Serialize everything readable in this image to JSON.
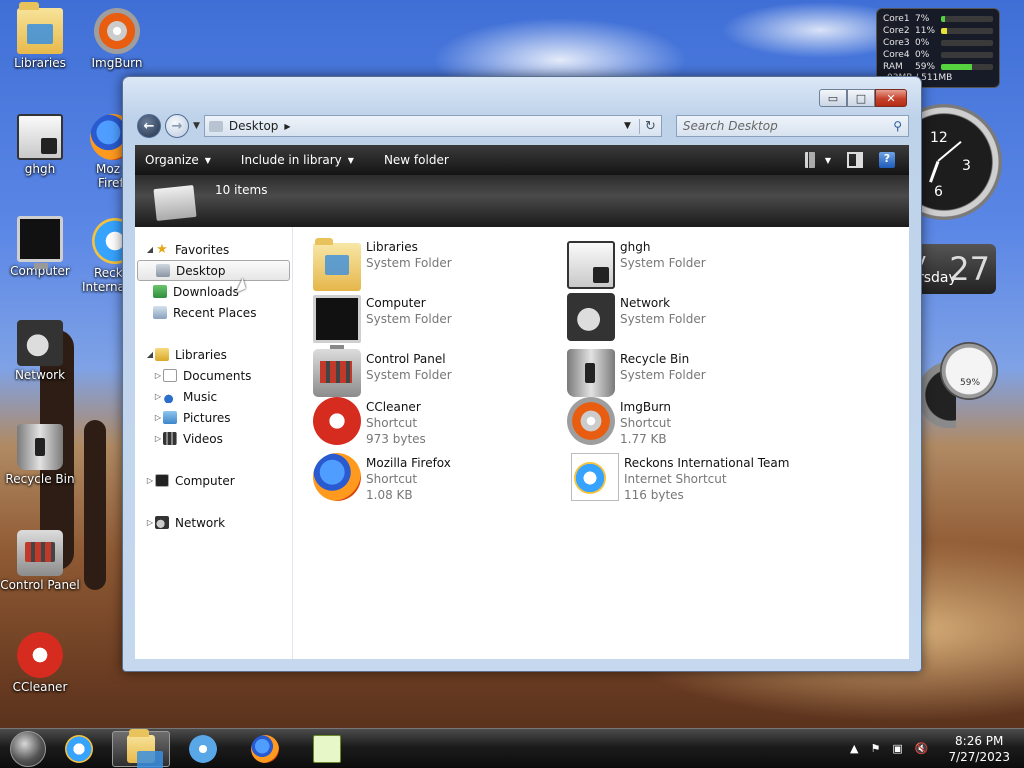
{
  "desktop": {
    "icons": [
      {
        "label": "Libraries",
        "icon": "libraries-icon"
      },
      {
        "label": "ImgBurn",
        "icon": "imgburn-icon"
      },
      {
        "label": "ghgh",
        "icon": "ghgh-icon"
      },
      {
        "label": "Moz",
        "sublabel": "Firef",
        "icon": "firefox-icon"
      },
      {
        "label": "Computer",
        "icon": "computer-icon"
      },
      {
        "label": "Reck",
        "sublabel": "Internat",
        "icon": "ie-icon"
      },
      {
        "label": "Network",
        "icon": "network-icon"
      },
      {
        "label": "Recycle Bin",
        "icon": "recycle-bin-icon"
      },
      {
        "label": "Control Panel",
        "icon": "control-panel-icon"
      },
      {
        "label": "CCleaner",
        "icon": "ccleaner-icon"
      }
    ]
  },
  "gadgets": {
    "cpu": {
      "rows": [
        {
          "label": "Core1",
          "value": "7%",
          "level": 0.07
        },
        {
          "label": "Core2",
          "value": "11%",
          "level": 0.11
        },
        {
          "label": "Core3",
          "value": "0%",
          "level": 0
        },
        {
          "label": "Core4",
          "value": "0%",
          "level": 0
        },
        {
          "label": "RAM",
          "value": "59%",
          "level": 0.59
        }
      ],
      "memory": "03MB / 511MB"
    },
    "clock": {
      "n12": "12",
      "n3": "3",
      "n6": "6"
    },
    "calendar": {
      "day": "y",
      "weekday": "rsday",
      "date": "27"
    },
    "meter": {
      "value": "59%"
    }
  },
  "window": {
    "caption": {
      "minimize": "▭",
      "maximize": "□",
      "close": "✕"
    },
    "address": {
      "location": "Desktop"
    },
    "search": {
      "placeholder": "Search Desktop"
    },
    "toolbar": {
      "organize": "Organize",
      "include_in_library": "Include in library",
      "new_folder": "New folder"
    },
    "details": {
      "count": "10 items"
    },
    "nav": {
      "favorites": "Favorites",
      "desktop": "Desktop",
      "downloads": "Downloads",
      "recent_places": "Recent Places",
      "libraries": "Libraries",
      "documents": "Documents",
      "music": "Music",
      "pictures": "Pictures",
      "videos": "Videos",
      "computer": "Computer",
      "network": "Network"
    },
    "files": [
      {
        "name": "Libraries",
        "type": "System Folder",
        "icon": "libraries-icon"
      },
      {
        "name": "ghgh",
        "type": "System Folder",
        "icon": "ghgh-icon"
      },
      {
        "name": "Computer",
        "type": "System Folder",
        "icon": "computer-icon"
      },
      {
        "name": "Network",
        "type": "System Folder",
        "icon": "network-icon"
      },
      {
        "name": "Control Panel",
        "type": "System Folder",
        "icon": "control-panel-icon"
      },
      {
        "name": "Recycle Bin",
        "type": "System Folder",
        "icon": "recycle-bin-icon"
      },
      {
        "name": "CCleaner",
        "type": "Shortcut",
        "size": "973 bytes",
        "icon": "ccleaner-icon"
      },
      {
        "name": "ImgBurn",
        "type": "Shortcut",
        "size": "1.77 KB",
        "icon": "imgburn-icon"
      },
      {
        "name": "Mozilla Firefox",
        "type": "Shortcut",
        "size": "1.08 KB",
        "icon": "firefox-icon"
      },
      {
        "name": "Reckons International Team",
        "type": "Internet Shortcut",
        "size": "116 bytes",
        "icon": "ie-icon"
      }
    ]
  },
  "taskbar": {
    "clock_time": "8:26 PM",
    "clock_date": "7/27/2023"
  }
}
